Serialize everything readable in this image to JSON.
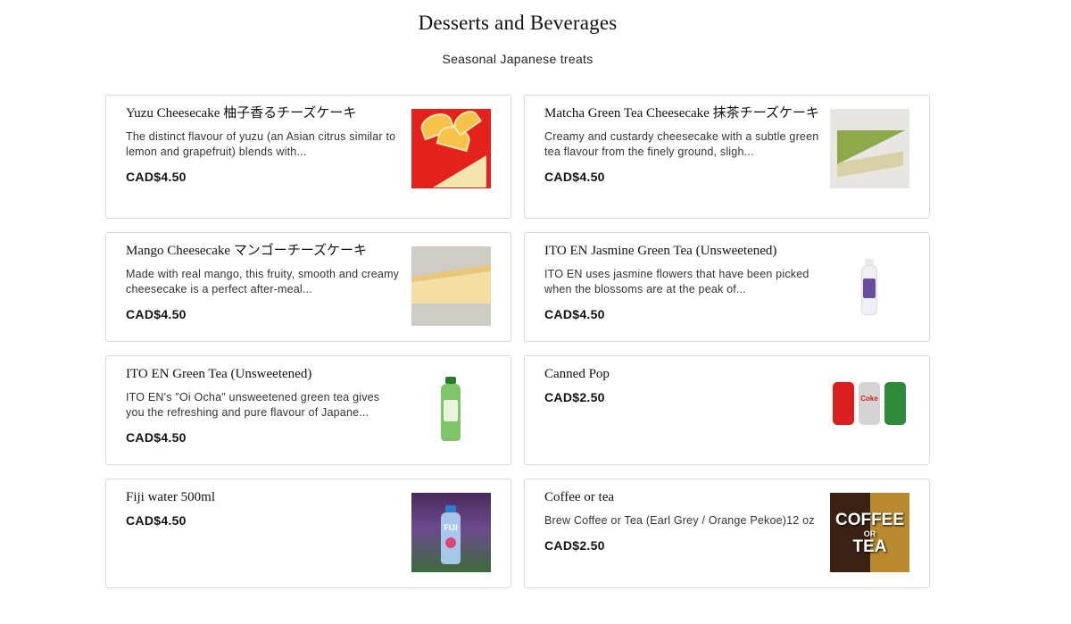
{
  "header": {
    "title": "Desserts and Beverages",
    "subtitle": "Seasonal Japanese treats"
  },
  "items": [
    {
      "name": "Yuzu Cheesecake 柚子香るチーズケーキ",
      "description": "The distinct flavour of yuzu (an Asian citrus similar to lemon and grapefruit) blends with...",
      "price": "CAD$4.50"
    },
    {
      "name": "Matcha Green Tea Cheesecake 抹茶チーズケーキ",
      "description": "Creamy and custardy cheesecake with a subtle green tea flavour from the finely ground, sligh...",
      "price": "CAD$4.50"
    },
    {
      "name": "Mango Cheesecake マンゴーチーズケーキ",
      "description": "Made with real mango, this fruity, smooth and creamy cheesecake is a perfect after-meal...",
      "price": "CAD$4.50"
    },
    {
      "name": "ITO EN Jasmine Green Tea (Unsweetened)",
      "description": "ITO EN uses jasmine flowers that have been picked when the blossoms are at the peak of...",
      "price": "CAD$4.50"
    },
    {
      "name": "ITO EN Green Tea (Unsweetened)",
      "description": "ITO EN's \"Oi Ocha\" unsweetened green tea gives you the refreshing and pure flavour of Japane...",
      "price": "CAD$4.50"
    },
    {
      "name": "Canned Pop",
      "description": "",
      "price": "CAD$2.50"
    },
    {
      "name": "Fiji water 500ml",
      "description": "",
      "price": "CAD$4.50"
    },
    {
      "name": "Coffee or tea",
      "description": "Brew Coffee or Tea (Earl Grey / Orange Pekoe)12 oz",
      "price": "CAD$2.50"
    }
  ],
  "images": {
    "coffee_word_1": "COFFEE",
    "coffee_word_2": "OR",
    "coffee_word_3": "TEA",
    "fiji_label": "FIJI",
    "coke_label": "Coke"
  }
}
